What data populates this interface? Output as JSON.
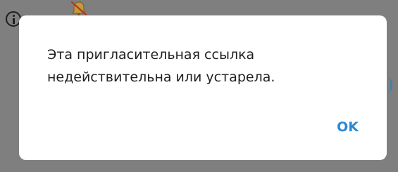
{
  "background": {
    "info_icon": "info-icon",
    "bell_icon": "muted-bell-icon"
  },
  "dialog": {
    "message_line1": "Эта пригласительная ссылка",
    "message_line2": "недействительна или устарела.",
    "ok_label": "OK"
  },
  "colors": {
    "accent": "#2a8ad0",
    "dialog_bg": "#ffffff",
    "overlay": "#7f7f7f",
    "text": "#1f1f1f"
  }
}
